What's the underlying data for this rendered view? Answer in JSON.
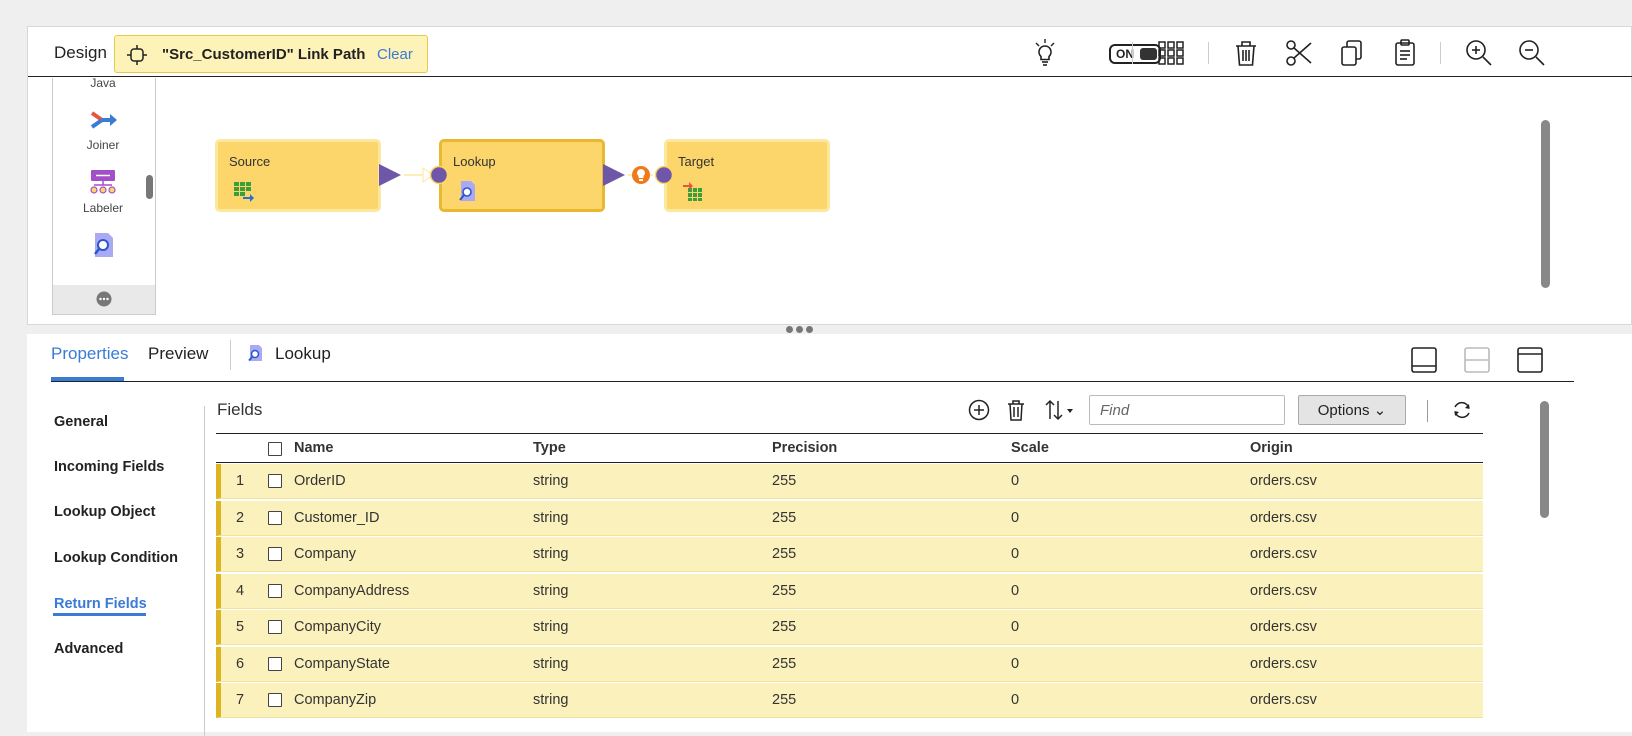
{
  "design": {
    "label": "Design",
    "link_path_title": "\"Src_CustomerID\" Link Path",
    "clear_label": "Clear",
    "toggle_label": "ON"
  },
  "palette": {
    "items": [
      {
        "label": "Java",
        "icon": "java-icon"
      },
      {
        "label": "Joiner",
        "icon": "joiner-icon"
      },
      {
        "label": "Labeler",
        "icon": "labeler-icon"
      },
      {
        "label": "",
        "icon": "lookup-icon"
      }
    ]
  },
  "canvas": {
    "nodes": [
      {
        "label": "Source",
        "icon": "source-table-icon"
      },
      {
        "label": "Lookup",
        "icon": "lookup-icon"
      },
      {
        "label": "Target",
        "icon": "target-table-icon"
      }
    ]
  },
  "properties": {
    "tabs": {
      "properties": "Properties",
      "preview": "Preview"
    },
    "selected_object": "Lookup",
    "nav": [
      "General",
      "Incoming Fields",
      "Lookup Object",
      "Lookup Condition",
      "Return Fields",
      "Advanced"
    ],
    "active_nav": "Return Fields"
  },
  "fields": {
    "title": "Fields",
    "find_placeholder": "Find",
    "options_label": "Options",
    "columns": [
      "Name",
      "Type",
      "Precision",
      "Scale",
      "Origin"
    ],
    "rows": [
      {
        "num": "1",
        "name": "OrderID",
        "type": "string",
        "precision": "255",
        "scale": "0",
        "origin": "orders.csv"
      },
      {
        "num": "2",
        "name": "Customer_ID",
        "type": "string",
        "precision": "255",
        "scale": "0",
        "origin": "orders.csv"
      },
      {
        "num": "3",
        "name": "Company",
        "type": "string",
        "precision": "255",
        "scale": "0",
        "origin": "orders.csv"
      },
      {
        "num": "4",
        "name": "CompanyAddress",
        "type": "string",
        "precision": "255",
        "scale": "0",
        "origin": "orders.csv"
      },
      {
        "num": "5",
        "name": "CompanyCity",
        "type": "string",
        "precision": "255",
        "scale": "0",
        "origin": "orders.csv"
      },
      {
        "num": "6",
        "name": "CompanyState",
        "type": "string",
        "precision": "255",
        "scale": "0",
        "origin": "orders.csv"
      },
      {
        "num": "7",
        "name": "CompanyZip",
        "type": "string",
        "precision": "255",
        "scale": "0",
        "origin": "orders.csv"
      }
    ]
  },
  "colors": {
    "accent": "#3a7bd5",
    "node_fill": "#fcd66a",
    "row_highlight": "#fbf1bc",
    "row_marker": "#e0b320"
  }
}
